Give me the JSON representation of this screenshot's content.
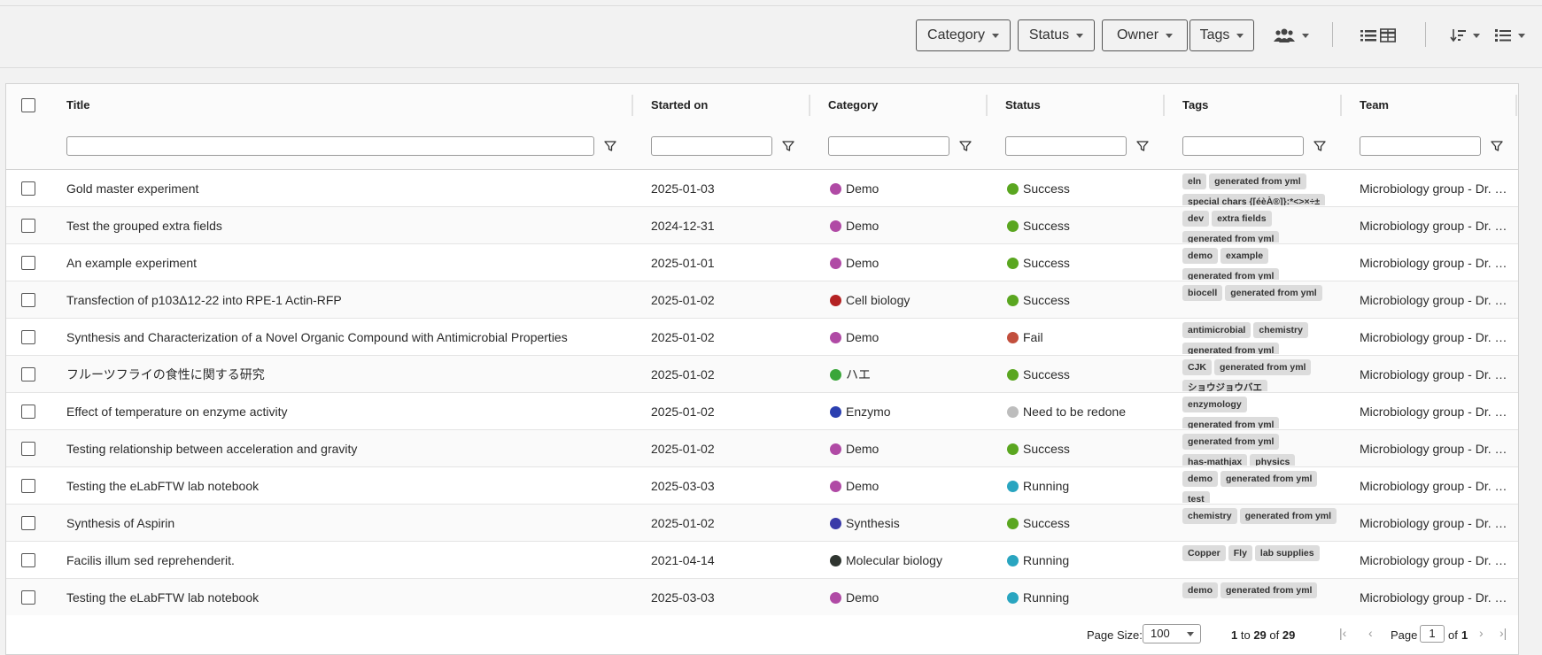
{
  "toolbar": {
    "filters": [
      "Category",
      "Status",
      "Owner",
      "Tags"
    ]
  },
  "columns": [
    {
      "label": "Title"
    },
    {
      "label": "Started on"
    },
    {
      "label": "Category"
    },
    {
      "label": "Status"
    },
    {
      "label": "Tags"
    },
    {
      "label": "Team"
    }
  ],
  "rows": [
    {
      "title": "Gold master experiment",
      "date": "2025-01-03",
      "category": "Demo",
      "category_color": "#b04aa5",
      "status": "Success",
      "status_color": "#5aa620",
      "tags": [
        "eln",
        "generated from yml",
        "special chars {[éèÀ®]}:*<>×÷±"
      ],
      "team": "Microbiology group - Dr. Pasteur"
    },
    {
      "title": "Test the grouped extra fields",
      "date": "2024-12-31",
      "category": "Demo",
      "category_color": "#b04aa5",
      "status": "Success",
      "status_color": "#5aa620",
      "tags": [
        "dev",
        "extra fields",
        "generated from yml"
      ],
      "team": "Microbiology group - Dr. Pasteur"
    },
    {
      "title": "An example experiment",
      "date": "2025-01-01",
      "category": "Demo",
      "category_color": "#b04aa5",
      "status": "Success",
      "status_color": "#5aa620",
      "tags": [
        "demo",
        "example",
        "generated from yml"
      ],
      "team": "Microbiology group - Dr. Pasteur"
    },
    {
      "title": "Transfection of p103Δ12-22 into RPE-1 Actin-RFP",
      "date": "2025-01-02",
      "category": "Cell biology",
      "category_color": "#b42223",
      "status": "Success",
      "status_color": "#5aa620",
      "tags": [
        "biocell",
        "generated from yml"
      ],
      "team": "Microbiology group - Dr. Pasteur"
    },
    {
      "title": "Synthesis and Characterization of a Novel Organic Compound with Antimicrobial Properties",
      "date": "2025-01-02",
      "category": "Demo",
      "category_color": "#b04aa5",
      "status": "Fail",
      "status_color": "#c24f3d",
      "tags": [
        "antimicrobial",
        "chemistry",
        "generated from yml"
      ],
      "team": "Microbiology group - Dr. Pasteur"
    },
    {
      "title": "フルーツフライの食性に関する研究",
      "date": "2025-01-02",
      "category": "ハエ",
      "category_color": "#3aa63a",
      "status": "Success",
      "status_color": "#5aa620",
      "tags": [
        "CJK",
        "generated from yml",
        "ショウジョウバエ"
      ],
      "team": "Microbiology group - Dr. Pasteur"
    },
    {
      "title": "Effect of temperature on enzyme activity",
      "date": "2025-01-02",
      "category": "Enzymo",
      "category_color": "#2b3fb0",
      "status": "Need to be redone",
      "status_color": "#bdbdbd",
      "tags": [
        "enzymology",
        "generated from yml"
      ],
      "team": "Microbiology group - Dr. Pasteur"
    },
    {
      "title": "Testing relationship between acceleration and gravity",
      "date": "2025-01-02",
      "category": "Demo",
      "category_color": "#b04aa5",
      "status": "Success",
      "status_color": "#5aa620",
      "tags": [
        "generated from yml",
        "has-mathjax",
        "physics"
      ],
      "team": "Microbiology group - Dr. Pasteur"
    },
    {
      "title": "Testing the eLabFTW lab notebook",
      "date": "2025-03-03",
      "category": "Demo",
      "category_color": "#b04aa5",
      "status": "Running",
      "status_color": "#29a5c0",
      "tags": [
        "demo",
        "generated from yml",
        "test"
      ],
      "team": "Microbiology group - Dr. Pasteur"
    },
    {
      "title": "Synthesis of Aspirin",
      "date": "2025-01-02",
      "category": "Synthesis",
      "category_color": "#3a3aa8",
      "status": "Success",
      "status_color": "#5aa620",
      "tags": [
        "chemistry",
        "generated from yml"
      ],
      "team": "Microbiology group - Dr. Pasteur"
    },
    {
      "title": "Facilis illum sed reprehenderit.",
      "date": "2021-04-14",
      "category": "Molecular biology",
      "category_color": "#2f3530",
      "status": "Running",
      "status_color": "#29a5c0",
      "tags": [
        "Copper",
        "Fly",
        "lab supplies"
      ],
      "team": "Microbiology group - Dr. Pasteur"
    },
    {
      "title": "Testing the eLabFTW lab notebook",
      "date": "2025-03-03",
      "category": "Demo",
      "category_color": "#b04aa5",
      "status": "Running",
      "status_color": "#29a5c0",
      "tags": [
        "demo",
        "generated from yml"
      ],
      "team": "Microbiology group - Dr. Pasteur"
    }
  ],
  "footer": {
    "page_size_label": "Page Size:",
    "page_size_value": "100",
    "range_from": "1",
    "range_to_word": "to",
    "range_to": "29",
    "range_of_word": "of",
    "range_total": "29",
    "page_label": "Page",
    "page_current": "1",
    "page_of_word": "of",
    "page_total": "1"
  }
}
